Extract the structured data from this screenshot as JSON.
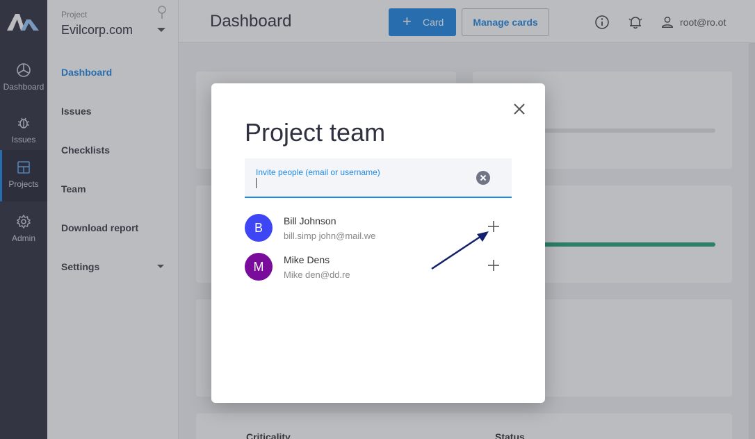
{
  "rail": {
    "items": [
      {
        "label": "Dashboard",
        "icon": "dashboard-icon"
      },
      {
        "label": "Issues",
        "icon": "bug-icon"
      },
      {
        "label": "Projects",
        "icon": "projects-icon"
      },
      {
        "label": "Admin",
        "icon": "gear-icon"
      }
    ]
  },
  "sidebar": {
    "project_caption": "Project",
    "project_name": "Evilcorp.com",
    "items": [
      {
        "label": "Dashboard"
      },
      {
        "label": "Issues"
      },
      {
        "label": "Checklists"
      },
      {
        "label": "Team"
      },
      {
        "label": "Download report"
      },
      {
        "label": "Settings"
      }
    ]
  },
  "header": {
    "title": "Dashboard",
    "card_button": "Card",
    "manage_button": "Manage cards",
    "user": "root@ro.ot"
  },
  "background": {
    "col_criticality": "Criticality",
    "col_status": "Status",
    "progress_color": "#21a37a",
    "bar_color": "#e2e3e7",
    "progress_fraction": 0.0
  },
  "modal": {
    "title": "Project team",
    "invite_label": "Invite people (email or username)",
    "invite_value": "",
    "members": [
      {
        "initial": "B",
        "name": "Bill Johnson",
        "email": "bill.simp john@mail.we",
        "avatar_color": "#3d45f5"
      },
      {
        "initial": "M",
        "name": "Mike Dens",
        "email": "Mike den@dd.re",
        "avatar_color": "#7a0c9c"
      }
    ]
  },
  "colors": {
    "accent": "#1e88e5",
    "rail_bg": "#2e3040",
    "arrow": "#12206b"
  }
}
